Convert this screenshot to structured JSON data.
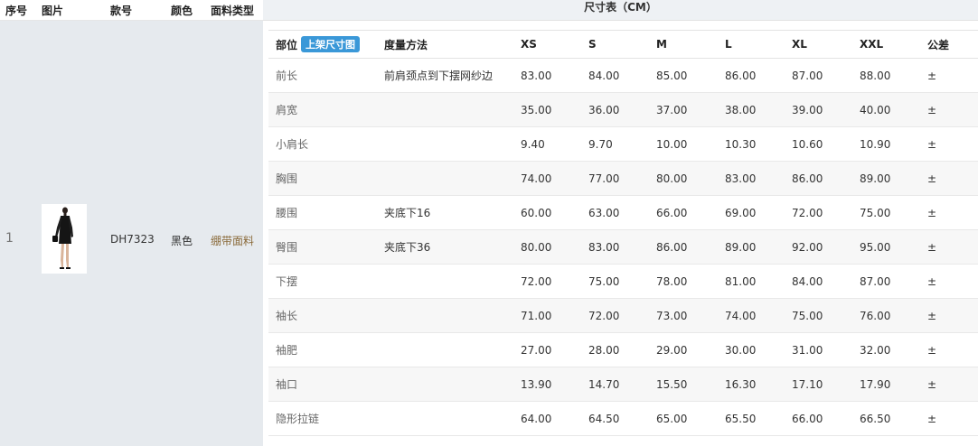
{
  "left_header": {
    "seq": "序号",
    "image": "图片",
    "style": "款号",
    "color": "颜色",
    "fabric": "面料类型"
  },
  "product": {
    "index": "1",
    "style_no": "DH7323",
    "color": "黑色",
    "fabric": "绷带面料"
  },
  "size_table": {
    "title": "尺寸表（CM）",
    "headers": {
      "part": "部位",
      "badge": "上架尺寸图",
      "method": "度量方法",
      "xs": "XS",
      "s": "S",
      "m": "M",
      "l": "L",
      "xl": "XL",
      "xxl": "XXL",
      "tol": "公差"
    },
    "rows": [
      {
        "part": "前长",
        "method": "前肩颈点到下摆网纱边",
        "xs": "83.00",
        "s": "84.00",
        "m": "85.00",
        "l": "86.00",
        "xl": "87.00",
        "xxl": "88.00",
        "tol": "±"
      },
      {
        "part": "肩宽",
        "method": "",
        "xs": "35.00",
        "s": "36.00",
        "m": "37.00",
        "l": "38.00",
        "xl": "39.00",
        "xxl": "40.00",
        "tol": "±"
      },
      {
        "part": "小肩长",
        "method": "",
        "xs": "9.40",
        "s": "9.70",
        "m": "10.00",
        "l": "10.30",
        "xl": "10.60",
        "xxl": "10.90",
        "tol": "±"
      },
      {
        "part": "胸围",
        "method": "",
        "xs": "74.00",
        "s": "77.00",
        "m": "80.00",
        "l": "83.00",
        "xl": "86.00",
        "xxl": "89.00",
        "tol": "±"
      },
      {
        "part": "腰围",
        "method": "夹底下16",
        "xs": "60.00",
        "s": "63.00",
        "m": "66.00",
        "l": "69.00",
        "xl": "72.00",
        "xxl": "75.00",
        "tol": "±"
      },
      {
        "part": "臀围",
        "method": "夹底下36",
        "xs": "80.00",
        "s": "83.00",
        "m": "86.00",
        "l": "89.00",
        "xl": "92.00",
        "xxl": "95.00",
        "tol": "±"
      },
      {
        "part": "下摆",
        "method": "",
        "xs": "72.00",
        "s": "75.00",
        "m": "78.00",
        "l": "81.00",
        "xl": "84.00",
        "xxl": "87.00",
        "tol": "±"
      },
      {
        "part": "袖长",
        "method": "",
        "xs": "71.00",
        "s": "72.00",
        "m": "73.00",
        "l": "74.00",
        "xl": "75.00",
        "xxl": "76.00",
        "tol": "±"
      },
      {
        "part": "袖肥",
        "method": "",
        "xs": "27.00",
        "s": "28.00",
        "m": "29.00",
        "l": "30.00",
        "xl": "31.00",
        "xxl": "32.00",
        "tol": "±"
      },
      {
        "part": "袖口",
        "method": "",
        "xs": "13.90",
        "s": "14.70",
        "m": "15.50",
        "l": "16.30",
        "xl": "17.10",
        "xxl": "17.90",
        "tol": "±"
      },
      {
        "part": "隐形拉链",
        "method": "",
        "xs": "64.00",
        "s": "64.50",
        "m": "65.00",
        "l": "65.50",
        "xl": "66.00",
        "xxl": "66.50",
        "tol": "±"
      }
    ]
  }
}
